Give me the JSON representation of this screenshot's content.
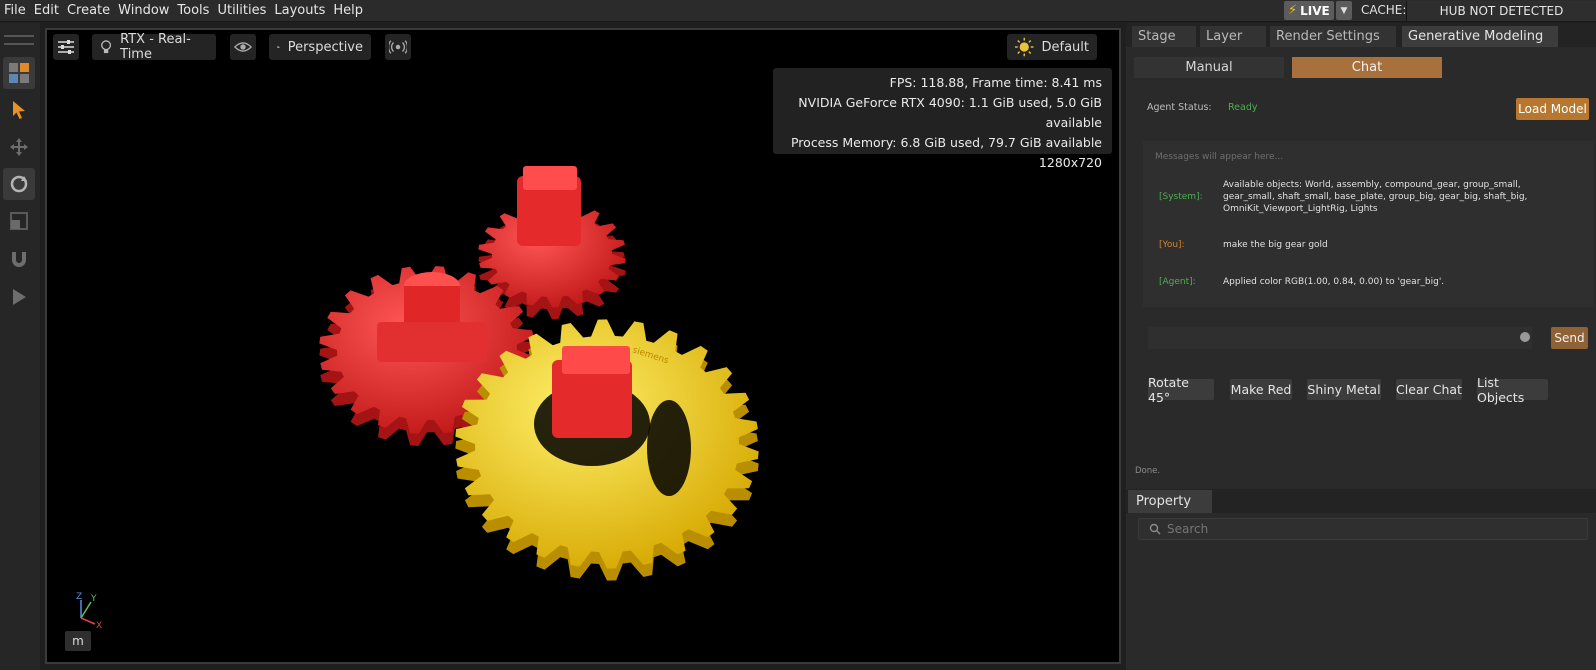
{
  "menu": [
    "File",
    "Edit",
    "Create",
    "Window",
    "Tools",
    "Utilities",
    "Layouts",
    "Help"
  ],
  "header": {
    "live_label": "LIVE",
    "cache_label": "CACHE:",
    "hub_status": "HUB NOT DETECTED"
  },
  "viewport": {
    "render_mode": "RTX - Real-Time",
    "camera": "Perspective",
    "lighting": "Default",
    "stats": [
      "FPS: 118.88, Frame time: 8.41 ms",
      "NVIDIA GeForce RTX 4090: 1.1 GiB used, 5.0 GiB available",
      "Process Memory: 6.8 GiB used, 79.7 GiB available",
      "1280x720"
    ],
    "unit": "m",
    "axes": {
      "z": "Z",
      "y": "Y",
      "x": "X"
    },
    "gear_engraving": "siemens"
  },
  "panel": {
    "tabs": [
      "Stage",
      "Layer",
      "Render Settings",
      "Generative Modeling"
    ],
    "active_tab": "Generative Modeling",
    "modes": [
      "Manual",
      "Chat"
    ],
    "active_mode": "Chat",
    "agent_status_label": "Agent Status:",
    "agent_status": "Ready",
    "load_model": "Load Model",
    "messages_placeholder": "Messages will appear here...",
    "messages": [
      {
        "who": "[System]:",
        "text": "Available objects: World, assembly, compound_gear, group_small, gear_small, shaft_small, base_plate, group_big, gear_big, shaft_big, OmniKit_Viewport_LightRig, Lights"
      },
      {
        "who": "[You]:",
        "text": "make the big gear gold"
      },
      {
        "who": "[Agent]:",
        "text": "Applied color RGB(1.00, 0.84, 0.00) to 'gear_big'."
      }
    ],
    "input_value": "",
    "send": "Send",
    "quick_actions": [
      "Rotate 45°",
      "Make Red",
      "Shiny Metal",
      "Clear Chat",
      "List Objects"
    ],
    "status_text": "Done."
  },
  "property": {
    "tab": "Property",
    "search_placeholder": "Search"
  },
  "colors": {
    "accent": "#b8772f",
    "active_mode": "#a8703a",
    "system": "#4caf50",
    "you": "#d9822b",
    "agent": "#4caf50",
    "gear_red": "#e53030",
    "gear_gold": "#f5d000"
  },
  "icons": [
    "settings-sliders-icon",
    "lightbulb-icon",
    "eye-icon",
    "camera-icon",
    "broadcast-icon",
    "sun-icon",
    "select-arrow-icon",
    "move-icon",
    "rotate-icon",
    "scale-icon",
    "snap-magnet-icon",
    "play-icon",
    "search-icon",
    "bolt-icon"
  ]
}
